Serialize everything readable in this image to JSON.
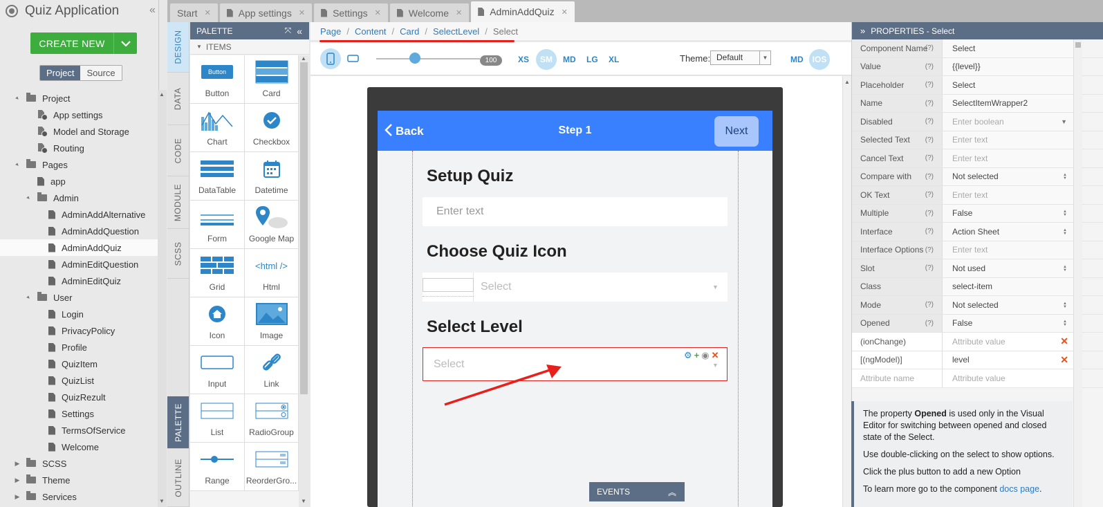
{
  "app": {
    "title": "Quiz Application",
    "create_label": "CREATE NEW"
  },
  "project_toggle": {
    "project": "Project",
    "source": "Source"
  },
  "tree": [
    {
      "label": "Project",
      "level": 0,
      "type": "folder",
      "open": true
    },
    {
      "label": "App settings",
      "level": 1,
      "type": "settings"
    },
    {
      "label": "Model and Storage",
      "level": 1,
      "type": "settings"
    },
    {
      "label": "Routing",
      "level": 1,
      "type": "settings"
    },
    {
      "label": "Pages",
      "level": 0,
      "type": "folder",
      "open": true
    },
    {
      "label": "app",
      "level": 1,
      "type": "file"
    },
    {
      "label": "Admin",
      "level": 1,
      "type": "folder",
      "open": true
    },
    {
      "label": "AdminAddAlternative",
      "level": 2,
      "type": "file"
    },
    {
      "label": "AdminAddQuestion",
      "level": 2,
      "type": "file"
    },
    {
      "label": "AdminAddQuiz",
      "level": 2,
      "type": "file",
      "selected": true
    },
    {
      "label": "AdminEditQuestion",
      "level": 2,
      "type": "file"
    },
    {
      "label": "AdminEditQuiz",
      "level": 2,
      "type": "file"
    },
    {
      "label": "User",
      "level": 1,
      "type": "folder",
      "open": true
    },
    {
      "label": "Login",
      "level": 2,
      "type": "file"
    },
    {
      "label": "PrivacyPolicy",
      "level": 2,
      "type": "file"
    },
    {
      "label": "Profile",
      "level": 2,
      "type": "file"
    },
    {
      "label": "QuizItem",
      "level": 2,
      "type": "file"
    },
    {
      "label": "QuizList",
      "level": 2,
      "type": "file"
    },
    {
      "label": "QuizRezult",
      "level": 2,
      "type": "file"
    },
    {
      "label": "Settings",
      "level": 2,
      "type": "file"
    },
    {
      "label": "TermsOfService",
      "level": 2,
      "type": "file"
    },
    {
      "label": "Welcome",
      "level": 2,
      "type": "file"
    },
    {
      "label": "SCSS",
      "level": 0,
      "type": "folder",
      "open": false
    },
    {
      "label": "Theme",
      "level": 0,
      "type": "folder",
      "open": false
    },
    {
      "label": "Services",
      "level": 0,
      "type": "folder",
      "open": false
    }
  ],
  "tabs": [
    {
      "label": "Start",
      "icon": "none"
    },
    {
      "label": "App settings",
      "icon": "settings-file-icon"
    },
    {
      "label": "Settings",
      "icon": "file-icon"
    },
    {
      "label": "Welcome",
      "icon": "file-icon"
    },
    {
      "label": "AdminAddQuiz",
      "icon": "file-icon",
      "active": true
    }
  ],
  "vtabs": {
    "design": "DESIGN",
    "data": "DATA",
    "code": "CODE",
    "module": "MODULE",
    "scss": "SCSS",
    "palette": "PALETTE",
    "outline": "OUTLINE"
  },
  "palette": {
    "title": "PALETTE",
    "items_header": "ITEMS",
    "items": [
      "Button",
      "Card",
      "Chart",
      "Checkbox",
      "DataTable",
      "Datetime",
      "Form",
      "Google Map",
      "Grid",
      "Html",
      "Icon",
      "Image",
      "Input",
      "Link",
      "List",
      "RadioGroup",
      "Range",
      "ReorderGro..."
    ],
    "button_icon_text": "Button",
    "html_icon_text": "<html />"
  },
  "breadcrumb": {
    "page": "Page",
    "content": "Content",
    "card": "Card",
    "selectlevel": "SelectLevel",
    "current": "Select"
  },
  "toolbar": {
    "zoom_value": "100",
    "zoom_fraction": 0.37,
    "breakpoints": [
      "XS",
      "SM",
      "MD",
      "LG",
      "XL"
    ],
    "active_breakpoint": "SM",
    "theme_label": "Theme:",
    "theme_value": "Default",
    "platforms": [
      "MD",
      "IOS"
    ]
  },
  "device": {
    "back_label": "Back",
    "title": "Step 1",
    "next_label": "Next",
    "setup_heading": "Setup Quiz",
    "input_placeholder": "Enter text",
    "icon_heading": "Choose Quiz Icon",
    "icon_select_placeholder": "Select",
    "level_heading": "Select Level",
    "level_select_placeholder": "Select",
    "events_label": "EVENTS"
  },
  "properties": {
    "title": "PROPERTIES - Select",
    "rows": [
      {
        "name": "Component Name",
        "help": "(?)",
        "value": "Select",
        "kind": "text"
      },
      {
        "name": "Value",
        "help": "(?)",
        "value": "{{level}}",
        "kind": "text"
      },
      {
        "name": "Placeholder",
        "help": "(?)",
        "value": "Select",
        "kind": "text"
      },
      {
        "name": "Name",
        "help": "(?)",
        "value": "SelectItemWrapper2",
        "kind": "text"
      },
      {
        "name": "Disabled",
        "help": "(?)",
        "value": "Enter boolean",
        "kind": "placeholder-dropdown"
      },
      {
        "name": "Selected Text",
        "help": "(?)",
        "value": "Enter text",
        "kind": "placeholder"
      },
      {
        "name": "Cancel Text",
        "help": "(?)",
        "value": "Enter text",
        "kind": "placeholder"
      },
      {
        "name": "Compare with",
        "help": "(?)",
        "value": "Not selected",
        "kind": "select"
      },
      {
        "name": "OK Text",
        "help": "(?)",
        "value": "Enter text",
        "kind": "placeholder"
      },
      {
        "name": "Multiple",
        "help": "(?)",
        "value": "False",
        "kind": "select"
      },
      {
        "name": "Interface",
        "help": "(?)",
        "value": "Action Sheet",
        "kind": "select"
      },
      {
        "name": "Interface Options",
        "help": "(?)",
        "value": "Enter text",
        "kind": "placeholder"
      },
      {
        "name": "Slot",
        "help": "(?)",
        "value": "Not used",
        "kind": "select"
      },
      {
        "name": "Class",
        "help": "",
        "value": "select-item",
        "kind": "text"
      },
      {
        "name": "Mode",
        "help": "(?)",
        "value": "Not selected",
        "kind": "select"
      },
      {
        "name": "Opened",
        "help": "(?)",
        "value": "False",
        "kind": "select"
      },
      {
        "name": "(ionChange)",
        "help": "",
        "value": "Attribute value",
        "kind": "placeholder-delete",
        "white": true
      },
      {
        "name": "[(ngModel)]",
        "help": "",
        "value": "level",
        "kind": "text-delete",
        "white": true
      },
      {
        "name": "Attribute name",
        "help": "",
        "value": "Attribute value",
        "kind": "placeholder",
        "white": true,
        "name_placeholder": true
      }
    ]
  },
  "info": {
    "p1_prefix": "The property ",
    "p1_bold": "Opened",
    "p1_suffix": " is used only in the Visual Editor for switching between opened and closed state of the Select.",
    "p2": "Use double-clicking on the select to show options.",
    "p3": "Click the plus button to add a new Option",
    "p4_prefix": "To learn more go to the component ",
    "p4_link": "docs page",
    "p4_suffix": "."
  },
  "colors": {
    "accent": "#3880ff",
    "panel_header": "#5b6e86",
    "create": "#3dae3d",
    "highlight": "#e8201c",
    "link": "#2c7bc0"
  }
}
